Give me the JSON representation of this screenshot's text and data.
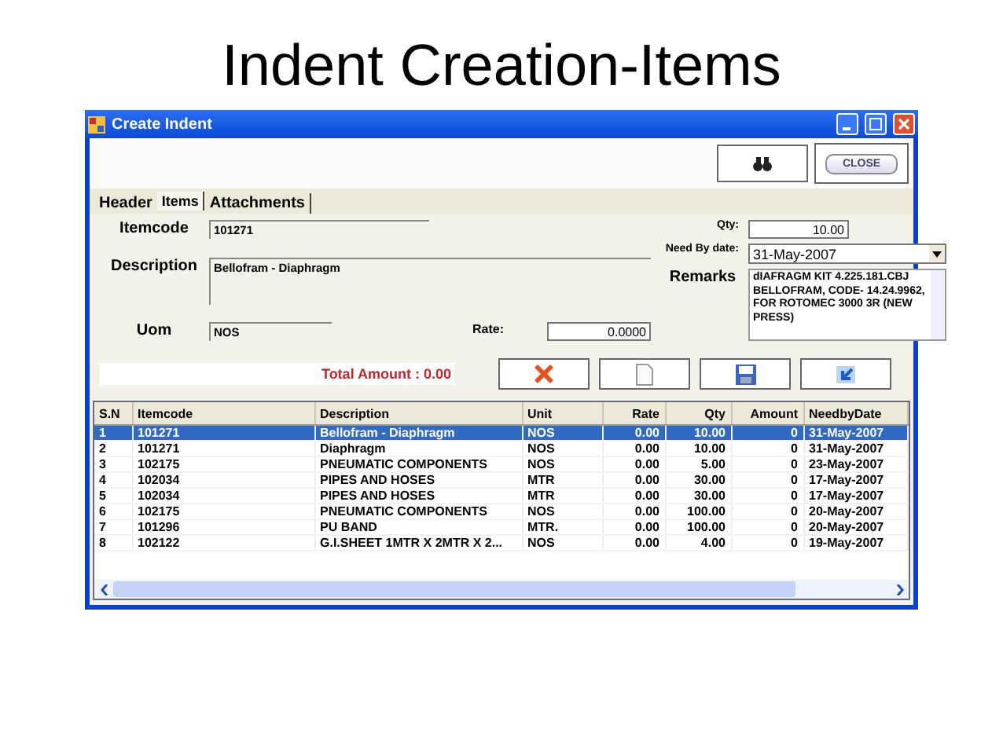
{
  "slide_title": "Indent Creation-Items",
  "window": {
    "title": "Create Indent"
  },
  "toolbar": {
    "close_label": "CLOSE"
  },
  "tabs": [
    {
      "label": "Header",
      "selected": false
    },
    {
      "label": "Items",
      "selected": true
    },
    {
      "label": "Attachments",
      "selected": false
    }
  ],
  "form": {
    "itemcode": {
      "label": "Itemcode",
      "value": "101271"
    },
    "description": {
      "label": "Description",
      "value": "Bellofram - Diaphragm"
    },
    "uom": {
      "label": "Uom",
      "value": "NOS"
    },
    "rate": {
      "label": "Rate:",
      "value": "0.0000"
    },
    "qty": {
      "label": "Qty:",
      "value": "10.00"
    },
    "need_by_date": {
      "label": "Need By date:",
      "value": "31-May-2007"
    },
    "remarks": {
      "label": "Remarks",
      "value": "dIAFRAGM KIT 4.225.181.CBJ BELLOFRAM, CODE- 14.24.9962, FOR ROTOMEC 3000 3R (NEW PRESS)"
    }
  },
  "total_amount": "Total Amount : 0.00",
  "action_buttons": [
    {
      "kind": "delete"
    },
    {
      "kind": "new"
    },
    {
      "kind": "save"
    },
    {
      "kind": "undo"
    }
  ],
  "table": {
    "columns": [
      "S.N",
      "Itemcode",
      "Description",
      "Unit",
      "Rate",
      "Qty",
      "Amount",
      "NeedbyDate"
    ],
    "rows": [
      {
        "selected": true,
        "cells": [
          "1",
          "101271",
          "Bellofram - Diaphragm",
          "NOS",
          "0.00",
          "10.00",
          "0",
          "31-May-2007"
        ]
      },
      {
        "selected": false,
        "cells": [
          "2",
          "101271",
          "Diaphragm",
          "NOS",
          "0.00",
          "10.00",
          "0",
          "31-May-2007"
        ]
      },
      {
        "selected": false,
        "cells": [
          "3",
          "102175",
          "PNEUMATIC COMPONENTS",
          "NOS",
          "0.00",
          "5.00",
          "0",
          "23-May-2007"
        ]
      },
      {
        "selected": false,
        "cells": [
          "4",
          "102034",
          "PIPES AND HOSES",
          "MTR",
          "0.00",
          "30.00",
          "0",
          "17-May-2007"
        ]
      },
      {
        "selected": false,
        "cells": [
          "5",
          "102034",
          "PIPES AND HOSES",
          "MTR",
          "0.00",
          "30.00",
          "0",
          "17-May-2007"
        ]
      },
      {
        "selected": false,
        "cells": [
          "6",
          "102175",
          "PNEUMATIC COMPONENTS",
          "NOS",
          "0.00",
          "100.00",
          "0",
          "20-May-2007"
        ]
      },
      {
        "selected": false,
        "cells": [
          "7",
          "101296",
          "PU BAND",
          "MTR.",
          "0.00",
          "100.00",
          "0",
          "20-May-2007"
        ]
      },
      {
        "selected": false,
        "cells": [
          "8",
          "102122",
          "G.I.SHEET 1MTR X 2MTR X 2...",
          "NOS",
          "0.00",
          "4.00",
          "0",
          "19-May-2007"
        ]
      }
    ]
  }
}
